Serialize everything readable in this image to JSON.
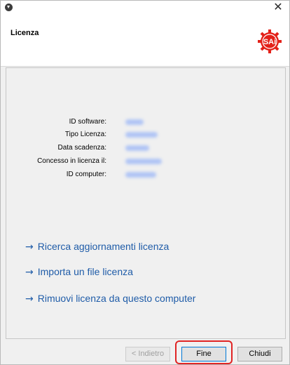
{
  "window": {
    "close_glyph": "✕"
  },
  "header": {
    "title": "Licenza",
    "logo_text": "SAi",
    "logo_color": "#e32119"
  },
  "info": {
    "rows": [
      {
        "label": "ID software:"
      },
      {
        "label": "Tipo Licenza:"
      },
      {
        "label": "Data scadenza:"
      },
      {
        "label": "Concesso in licenza il:"
      },
      {
        "label": "ID computer:"
      }
    ]
  },
  "links": [
    {
      "label": "Ricerca aggiornamenti licenza"
    },
    {
      "label": "Importa un file licenza"
    },
    {
      "label": "Rimuovi licenza da questo computer"
    }
  ],
  "link_arrow": "→",
  "buttons": {
    "back": "< Indietro",
    "finish": "Fine",
    "close": "Chiudi"
  },
  "colors": {
    "link": "#1f5ca8",
    "highlight": "#e02424",
    "blurred_value": "#a9c0f6"
  }
}
